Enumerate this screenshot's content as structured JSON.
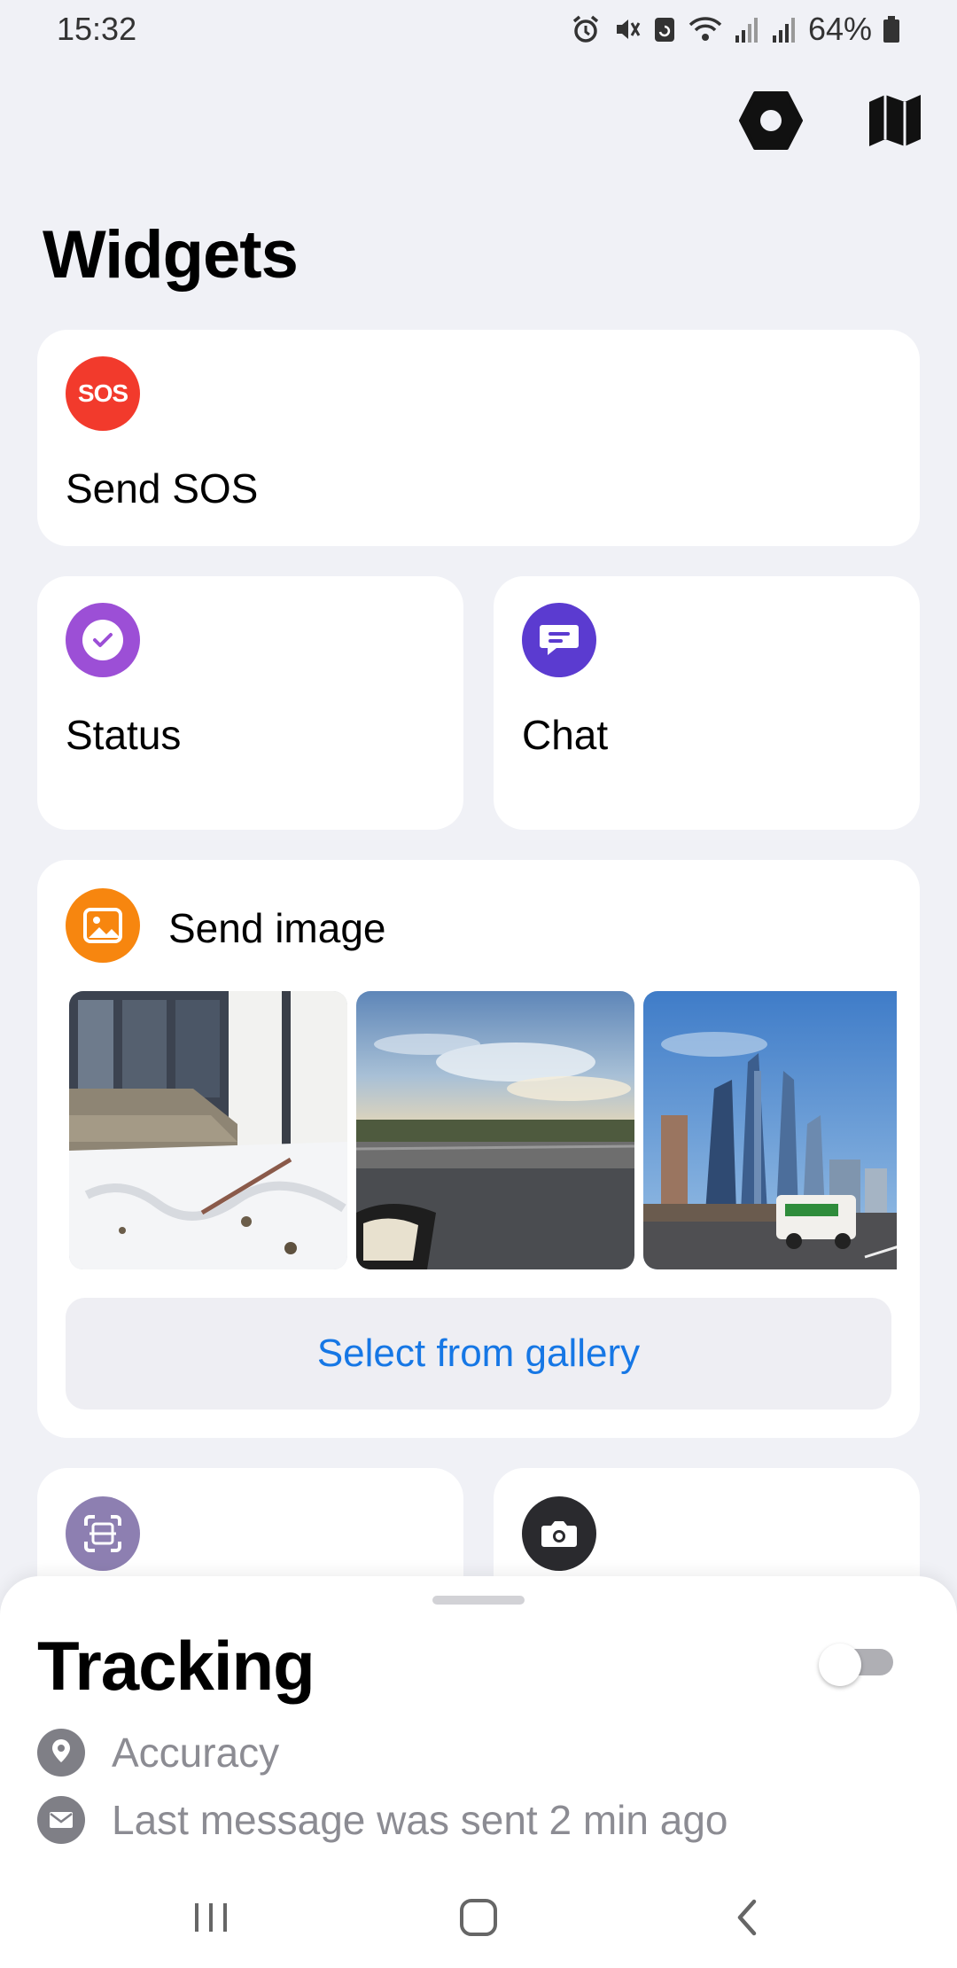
{
  "status_bar": {
    "time": "15:32",
    "battery": "64%",
    "icons": [
      "alarm-icon",
      "mute-icon",
      "sync-icon",
      "wifi-icon",
      "signal-icon",
      "signal-icon",
      "battery-icon"
    ]
  },
  "header": {
    "title": "Widgets",
    "actions": [
      {
        "name": "settings-icon"
      },
      {
        "name": "map-icon"
      }
    ]
  },
  "widgets": {
    "sos": {
      "label": "Send SOS",
      "badge": "SOS",
      "color": "#F23A2C"
    },
    "status": {
      "label": "Status",
      "icon": "check-circle-icon",
      "color": "#9C4FD6"
    },
    "chat": {
      "label": "Chat",
      "icon": "chat-bubble-icon",
      "color": "#5B3BD0"
    },
    "send_image": {
      "label": "Send image",
      "icon": "image-icon",
      "color": "#F7860F",
      "thumbnails": [
        {
          "name": "photo-snowy-porch"
        },
        {
          "name": "photo-road-sunset"
        },
        {
          "name": "photo-city-skyscrapers"
        }
      ],
      "gallery_button": "Select from gallery"
    },
    "scan": {
      "icon": "scan-icon",
      "color": "#8D7FB1"
    },
    "camera": {
      "icon": "camera-icon",
      "color": "#2A2A2E"
    }
  },
  "tracking": {
    "title": "Tracking",
    "enabled": false,
    "accuracy_label": "Accuracy",
    "last_message": "Last message was sent 2 min ago"
  },
  "navigation": {
    "buttons": [
      "recent-apps-icon",
      "home-icon",
      "back-icon"
    ]
  }
}
